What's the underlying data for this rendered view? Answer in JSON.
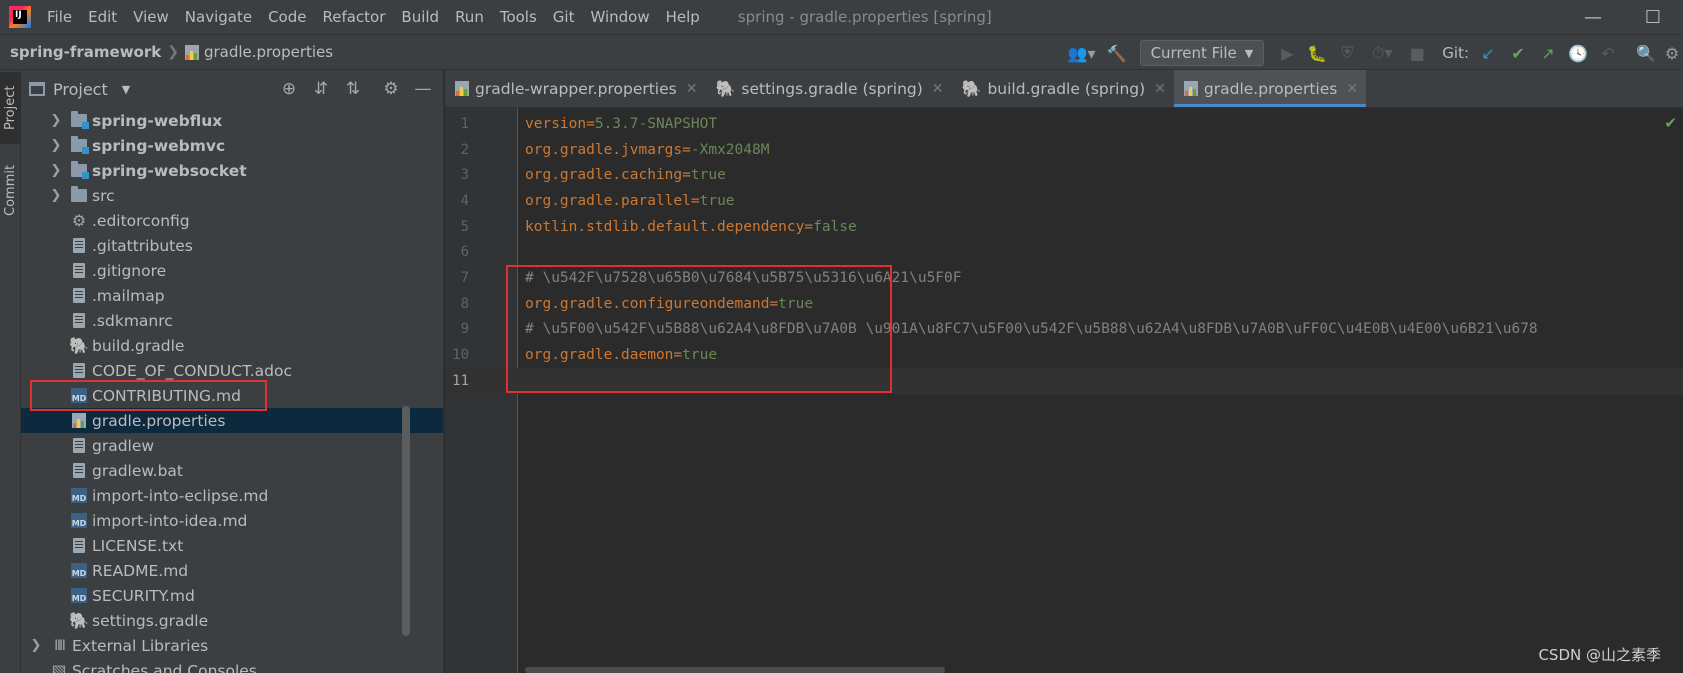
{
  "menu": {
    "items": [
      "File",
      "Edit",
      "View",
      "Navigate",
      "Code",
      "Refactor",
      "Build",
      "Run",
      "Tools",
      "Git",
      "Window",
      "Help"
    ],
    "window_title": "spring - gradle.properties [spring]"
  },
  "breadcrumb": {
    "project": "spring-framework",
    "file": "gradle.properties"
  },
  "toolbar": {
    "run_config": "Current File",
    "git_label": "Git:"
  },
  "tool_strip": {
    "project_tab": "Project",
    "commit_tab": "Commit"
  },
  "project_panel": {
    "title": "Project",
    "tree": [
      {
        "label": "spring-webflux",
        "icon": "module-folder",
        "bold": true,
        "expandable": true,
        "depth": 1
      },
      {
        "label": "spring-webmvc",
        "icon": "module-folder",
        "bold": true,
        "expandable": true,
        "depth": 1
      },
      {
        "label": "spring-websocket",
        "icon": "module-folder",
        "bold": true,
        "expandable": true,
        "depth": 1
      },
      {
        "label": "src",
        "icon": "folder",
        "bold": false,
        "expandable": true,
        "depth": 1
      },
      {
        "label": ".editorconfig",
        "icon": "gear",
        "depth": 1
      },
      {
        "label": ".gitattributes",
        "icon": "file",
        "depth": 1
      },
      {
        "label": ".gitignore",
        "icon": "file",
        "depth": 1
      },
      {
        "label": ".mailmap",
        "icon": "file",
        "depth": 1
      },
      {
        "label": ".sdkmanrc",
        "icon": "file",
        "depth": 1
      },
      {
        "label": "build.gradle",
        "icon": "gradle",
        "depth": 1
      },
      {
        "label": "CODE_OF_CONDUCT.adoc",
        "icon": "file",
        "depth": 1
      },
      {
        "label": "CONTRIBUTING.md",
        "icon": "markdown",
        "depth": 1
      },
      {
        "label": "gradle.properties",
        "icon": "properties",
        "depth": 1,
        "selected": true
      },
      {
        "label": "gradlew",
        "icon": "file",
        "depth": 1
      },
      {
        "label": "gradlew.bat",
        "icon": "file",
        "depth": 1
      },
      {
        "label": "import-into-eclipse.md",
        "icon": "markdown",
        "depth": 1
      },
      {
        "label": "import-into-idea.md",
        "icon": "markdown",
        "depth": 1
      },
      {
        "label": "LICENSE.txt",
        "icon": "file",
        "depth": 1
      },
      {
        "label": "README.md",
        "icon": "markdown",
        "depth": 1
      },
      {
        "label": "SECURITY.md",
        "icon": "markdown",
        "depth": 1
      },
      {
        "label": "settings.gradle",
        "icon": "gradle",
        "depth": 1
      },
      {
        "label": "External Libraries",
        "icon": "library",
        "expandable": true,
        "depth": 0
      },
      {
        "label": "Scratches and Consoles",
        "icon": "scratch",
        "depth": 0
      }
    ]
  },
  "editor_tabs": [
    {
      "label": "gradle-wrapper.properties",
      "icon": "properties",
      "active": false
    },
    {
      "label": "settings.gradle (spring)",
      "icon": "gradle",
      "active": false
    },
    {
      "label": "build.gradle (spring)",
      "icon": "gradle",
      "active": false
    },
    {
      "label": "gradle.properties",
      "icon": "properties",
      "active": true
    }
  ],
  "editor": {
    "lines": [
      {
        "n": "1",
        "key": "version",
        "value": "5.3.7-SNAPSHOT"
      },
      {
        "n": "2",
        "key": "org.gradle.jvmargs",
        "value": "-Xmx2048M"
      },
      {
        "n": "3",
        "key": "org.gradle.caching",
        "value": "true"
      },
      {
        "n": "4",
        "key": "org.gradle.parallel",
        "value": "true"
      },
      {
        "n": "5",
        "key": "kotlin.stdlib.default.dependency",
        "value": "false"
      },
      {
        "n": "6"
      },
      {
        "n": "7",
        "comment": "# \\u542F\\u7528\\u65B0\\u7684\\u5B75\\u5316\\u6A21\\u5F0F"
      },
      {
        "n": "8",
        "key": "org.gradle.configureondemand",
        "value": "true"
      },
      {
        "n": "9",
        "comment": "# \\u5F00\\u542F\\u5B88\\u62A4\\u8FDB\\u7A0B \\u901A\\u8FC7\\u5F00\\u542F\\u5B88\\u62A4\\u8FDB\\u7A0B\\uFF0C\\u4E0B\\u4E00\\u6B21\\u678"
      },
      {
        "n": "10",
        "key": "org.gradle.daemon",
        "value": "true"
      },
      {
        "n": "11",
        "current": true
      }
    ]
  },
  "watermark": "CSDN @山之素季",
  "colors": {
    "selection": "#0d293e",
    "highlight_box": "#e0302f",
    "key": "#cc7832",
    "value": "#6a8759",
    "comment": "#808080"
  }
}
